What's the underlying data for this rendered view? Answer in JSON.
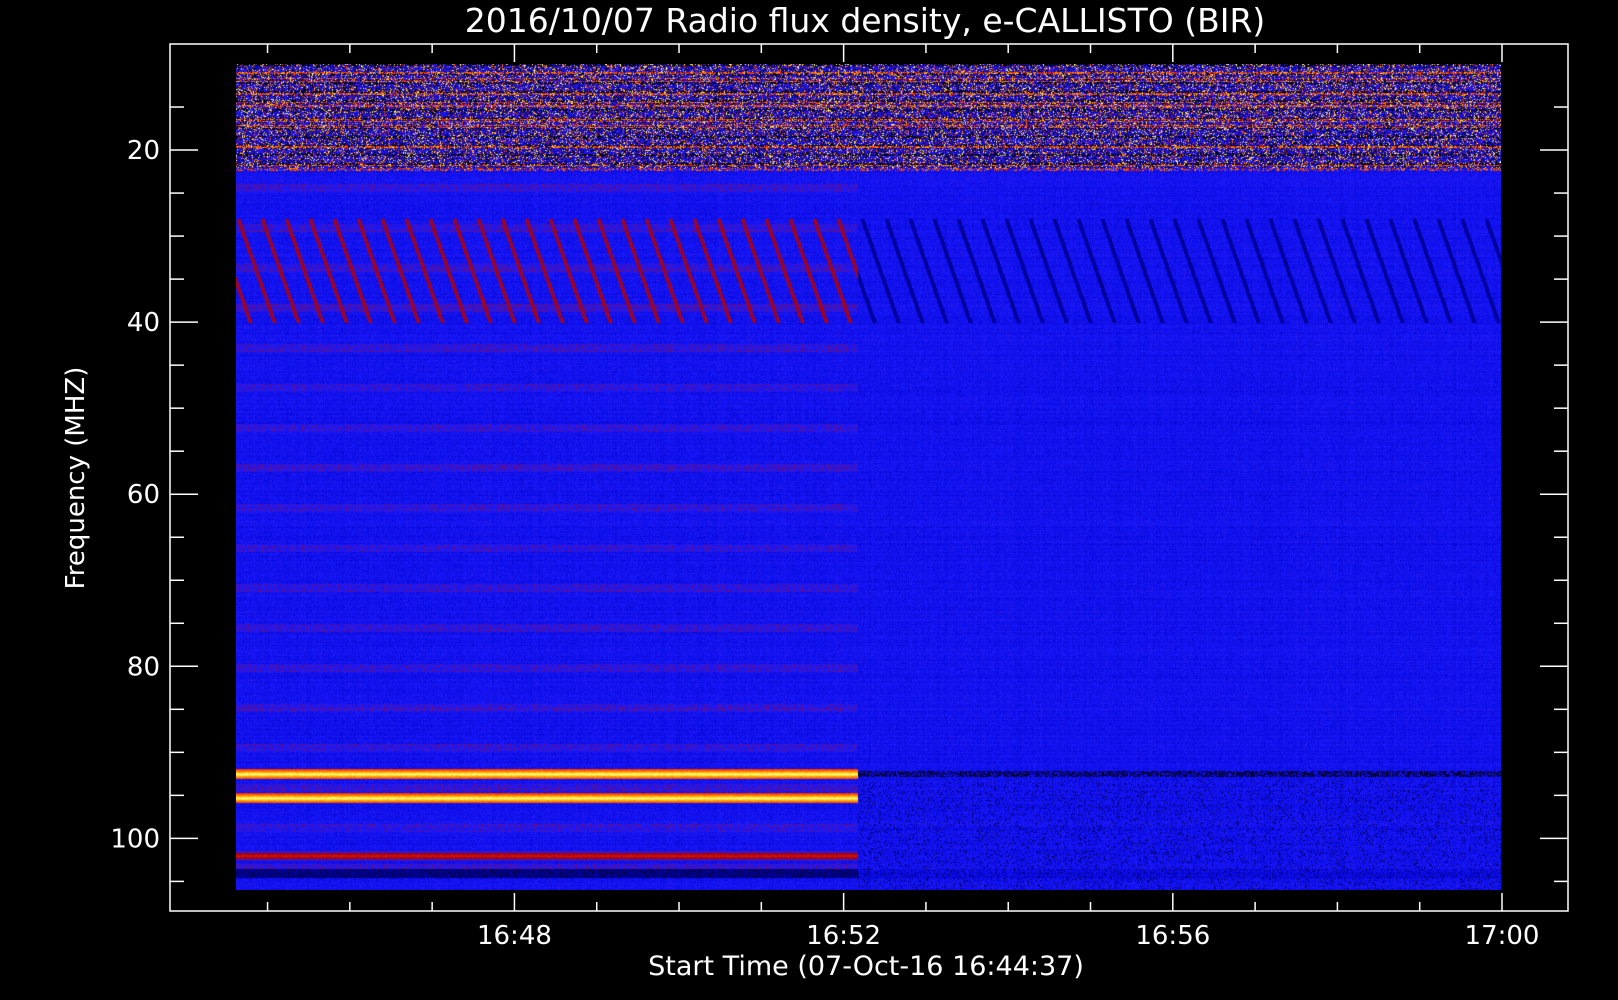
{
  "chart_data": {
    "type": "heatmap",
    "title": "2016/10/07  Radio flux density, e-CALLISTO (BIR)",
    "xlabel": "Start Time (07-Oct-16 16:44:37)",
    "ylabel": "Frequency (MHZ)",
    "x_ticks": [
      "16:48",
      "16:52",
      "16:56",
      "17:00"
    ],
    "y_ticks": [
      "20",
      "40",
      "60",
      "80",
      "100"
    ],
    "xlim": [
      "16:44:37",
      "17:00:00"
    ],
    "ylim": [
      10,
      106
    ],
    "y_inverted": true,
    "data_time_range": [
      "16:44:37",
      "16:59:59"
    ],
    "data_freq_range_mhz": [
      10,
      106
    ],
    "observed_features": {
      "instrument_change_time": "16:52:10",
      "rfi_band_mhz": [
        10,
        22
      ],
      "drifting_striations_mhz": [
        28,
        40
      ],
      "strong_bands_mhz_before_change": [
        92.5,
        95.3,
        102.0
      ]
    },
    "colormap": [
      "#000000",
      "#0000c8",
      "#1a1aff",
      "#b00000",
      "#ff3000",
      "#ff9a00",
      "#ffff60",
      "#ffffff"
    ],
    "background_color": "#000000",
    "axis_color": "#ffffff"
  }
}
